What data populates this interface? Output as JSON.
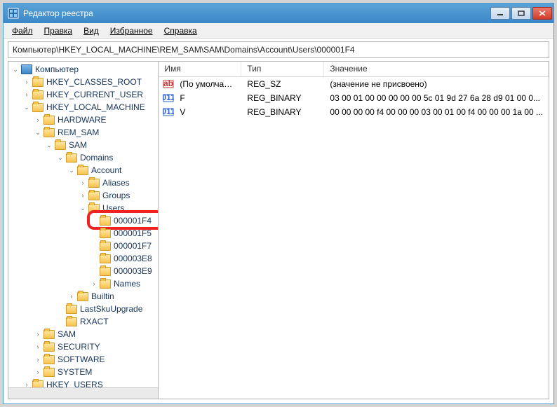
{
  "window": {
    "title": "Редактор реестра"
  },
  "menu": {
    "file": "Файл",
    "edit": "Правка",
    "view": "Вид",
    "favorites": "Избранное",
    "help": "Справка"
  },
  "address": "Компьютер\\HKEY_LOCAL_MACHINE\\REM_SAM\\SAM\\Domains\\Account\\Users\\000001F4",
  "tree": {
    "root": "Компьютер",
    "items": [
      "HKEY_CLASSES_ROOT",
      "HKEY_CURRENT_USER",
      "HKEY_LOCAL_MACHINE",
      "HARDWARE",
      "REM_SAM",
      "SAM",
      "Domains",
      "Account",
      "Aliases",
      "Groups",
      "Users",
      "000001F4",
      "000001F5",
      "000001F7",
      "000003E8",
      "000003E9",
      "Names",
      "Builtin",
      "LastSkuUpgrade",
      "RXACT",
      "SAM",
      "SECURITY",
      "SOFTWARE",
      "SYSTEM",
      "HKEY_USERS"
    ]
  },
  "list": {
    "headers": {
      "name": "Имя",
      "type": "Тип",
      "value": "Значение"
    },
    "rows": [
      {
        "name": "(По умолчанию)",
        "type": "REG_SZ",
        "value": "(значение не присвоено)",
        "iconType": "sz"
      },
      {
        "name": "F",
        "type": "REG_BINARY",
        "value": "03 00 01 00 00 00 00 00 5c 01 9d 27 6a 28 d9 01 00 0...",
        "iconType": "bin"
      },
      {
        "name": "V",
        "type": "REG_BINARY",
        "value": "00 00 00 00 f4 00 00 00 03 00 01 00 f4 00 00 00 1a 00 ...",
        "iconType": "bin"
      }
    ]
  },
  "colors": {
    "accent": "#3b87c7",
    "folder": "#f7c24b"
  }
}
